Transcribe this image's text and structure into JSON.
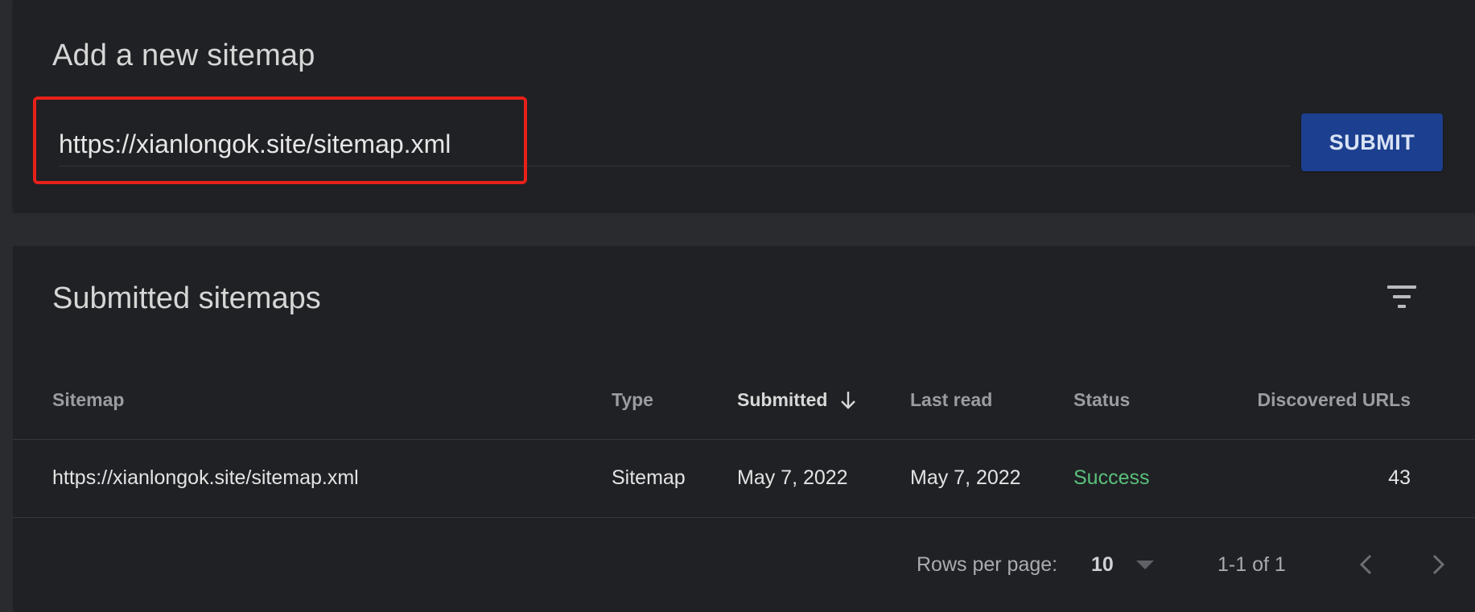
{
  "add_sitemap": {
    "title": "Add a new sitemap",
    "url_value": "https://xianlongok.site/sitemap.xml",
    "submit_label": "SUBMIT"
  },
  "submitted": {
    "title": "Submitted sitemaps",
    "columns": {
      "sitemap": "Sitemap",
      "type": "Type",
      "submitted": "Submitted",
      "last_read": "Last read",
      "status": "Status",
      "discovered": "Discovered URLs"
    },
    "rows": [
      {
        "sitemap": "https://xianlongok.site/sitemap.xml",
        "type": "Sitemap",
        "submitted": "May 7, 2022",
        "last_read": "May 7, 2022",
        "status": "Success",
        "discovered": "43"
      }
    ],
    "pagination": {
      "rows_label": "Rows per page:",
      "rows_value": "10",
      "range": "1-1 of 1"
    }
  },
  "colors": {
    "submit_bg": "#1c3f8f",
    "status_success": "#5ac07d",
    "highlight": "#e8201a"
  },
  "icons": {
    "filter": "filter-icon",
    "sort": "arrow-down-icon",
    "dropdown": "caret-down-icon",
    "prev": "chevron-left-icon",
    "next": "chevron-right-icon"
  }
}
